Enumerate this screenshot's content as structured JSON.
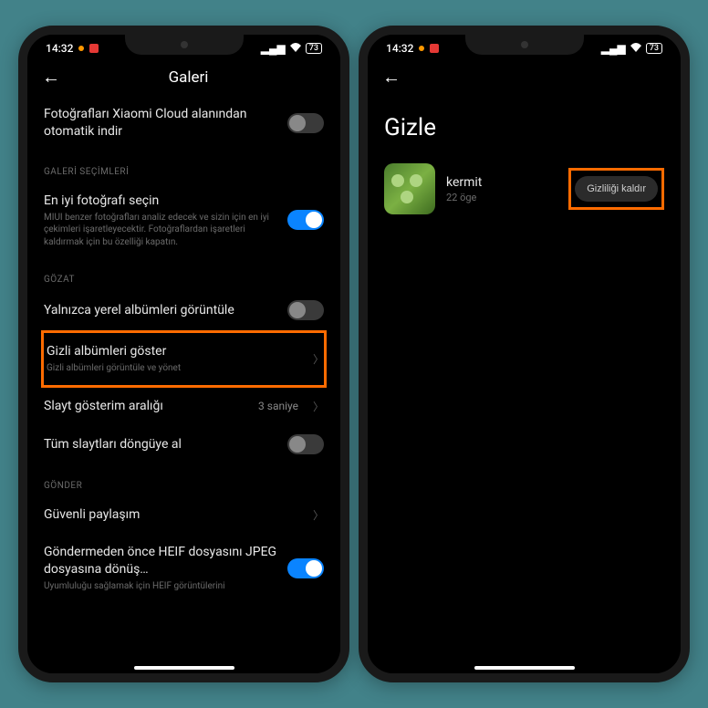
{
  "status": {
    "time": "14:32",
    "battery": "73"
  },
  "screen1": {
    "title": "Galeri",
    "row_cloud": {
      "label": "Fotoğrafları Xiaomi Cloud alanından otomatik indir"
    },
    "section_gallery": "GALERİ SEÇİMLERİ",
    "row_bestphoto": {
      "label": "En iyi fotoğrafı seçin",
      "desc": "MIUI benzer fotoğrafları analiz edecek ve sizin için en iyi çekimleri işaretleyecektir. Fotoğraflardan işaretleri kaldırmak için bu özelliği kapatın."
    },
    "section_browse": "GÖZAT",
    "row_localalbums": {
      "label": "Yalnızca yerel albümleri görüntüle"
    },
    "row_hiddenalbums": {
      "label": "Gizli albümleri göster",
      "desc": "Gizli albümleri görüntüle ve yönet"
    },
    "row_slideshow": {
      "label": "Slayt gösterim aralığı",
      "value": "3 saniye"
    },
    "row_loop": {
      "label": "Tüm slaytları döngüye al"
    },
    "section_send": "GÖNDER",
    "row_secureshare": {
      "label": "Güvenli paylaşım"
    },
    "row_heif": {
      "label": "Göndermeden önce HEIF dosyasını JPEG dosyasına dönüş…",
      "desc": "Uyumluluğu sağlamak için HEIF görüntülerini"
    }
  },
  "screen2": {
    "title": "Gizle",
    "album": {
      "name": "kermit",
      "count": "22 öge",
      "button": "Gizliliği kaldır"
    }
  }
}
